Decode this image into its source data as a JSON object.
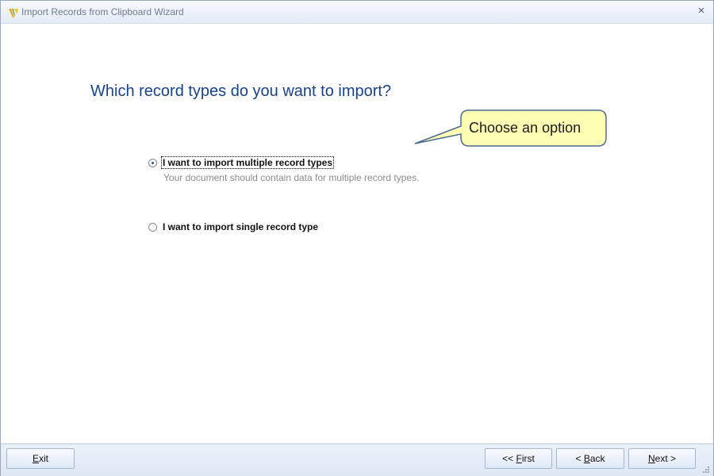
{
  "window": {
    "title": "Import Records from Clipboard Wizard",
    "close_glyph": "×",
    "app_icon": "app-logo-icon"
  },
  "main": {
    "heading": "Which record types do you want to import?",
    "callout_text": "Choose an option",
    "options": [
      {
        "label": "I want to import multiple record types",
        "description": "Your document should contain data for multiple record types.",
        "selected": true
      },
      {
        "label": "I want to import single record type",
        "selected": false
      }
    ]
  },
  "footer": {
    "exit": {
      "mnemonic": "E",
      "rest": "xit"
    },
    "first": {
      "prefix": "<< ",
      "mnemonic": "F",
      "rest": "irst"
    },
    "back": {
      "prefix": "< ",
      "mnemonic": "B",
      "rest": "ack"
    },
    "next": {
      "mnemonic": "N",
      "rest": "ext",
      "suffix": " >"
    }
  },
  "colors": {
    "heading": "#15428b",
    "callout_fill": "#ffffb4",
    "callout_border": "#4a6a96"
  }
}
